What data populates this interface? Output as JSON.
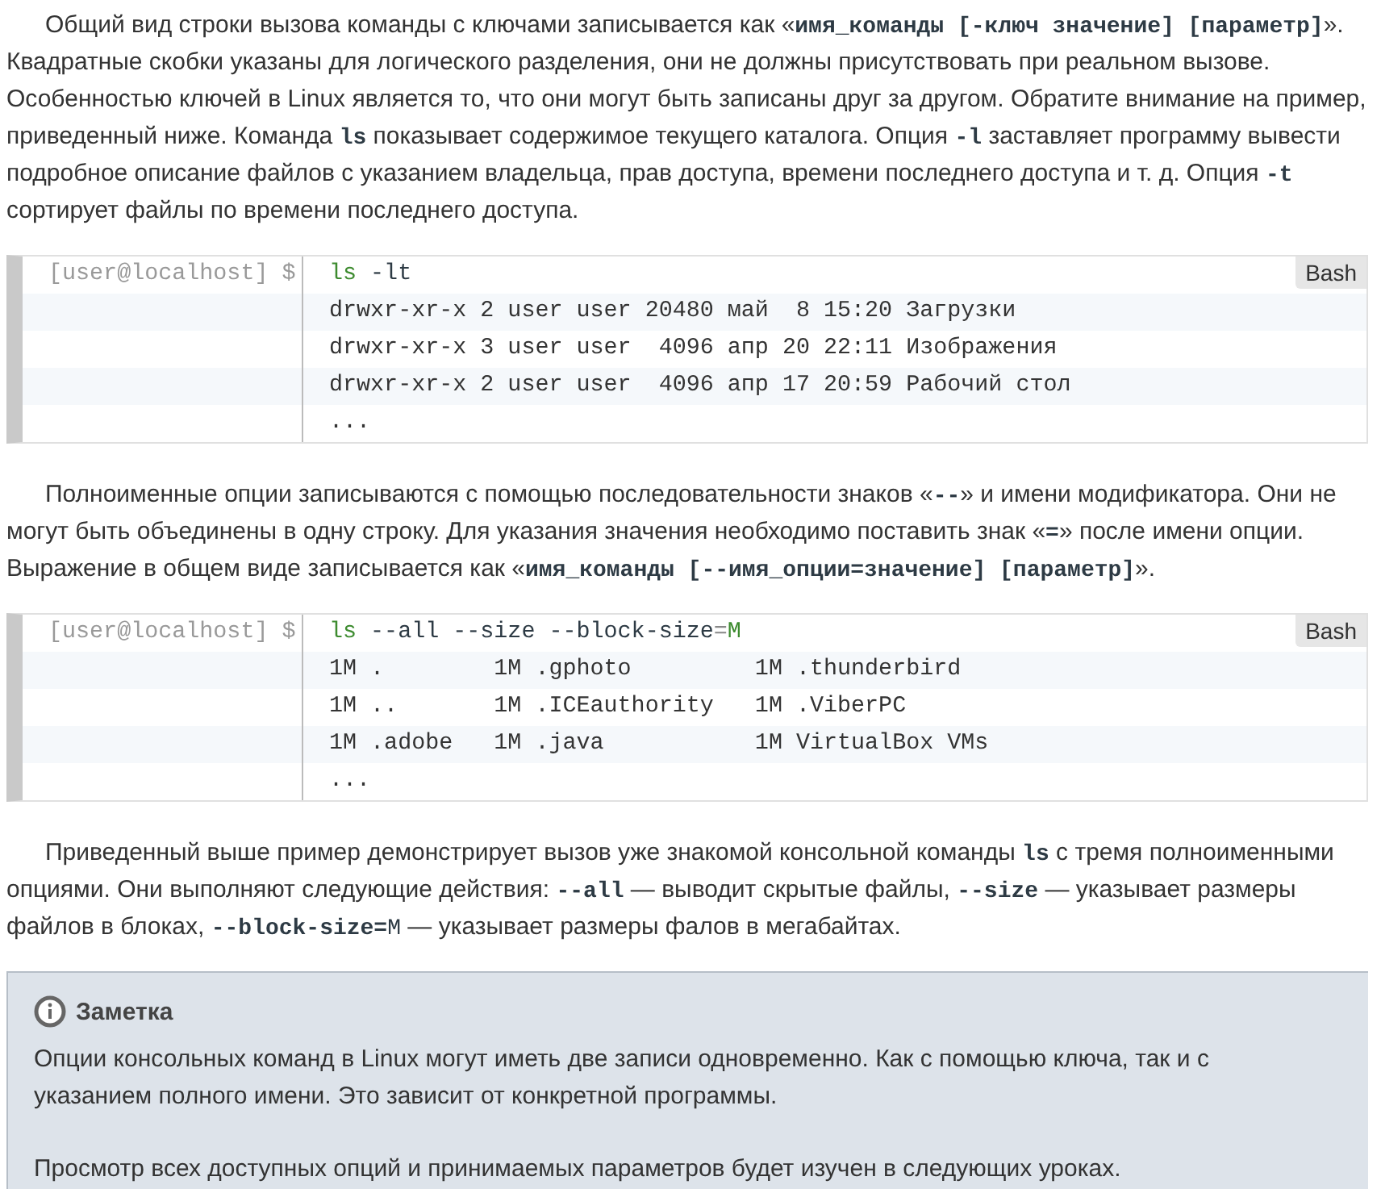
{
  "paragraphs_top": [
    {
      "segments": [
        {
          "kind": "text",
          "text": "Общий вид строки вызова команды с ключами записывается как «"
        },
        {
          "kind": "code",
          "text": "имя_команды [-ключ значение] [параметр]"
        },
        {
          "kind": "text",
          "text": "». Квадратные скобки указаны для логического разделения, они не должны присутствовать при реальном вызове. Особенностью ключей в Linux является то, что они могут быть записаны друг за другом. Обратите внимание на пример, приведенный ниже. Команда "
        },
        {
          "kind": "code",
          "text": "ls"
        },
        {
          "kind": "text",
          "text": " показывает содержимое текущего каталога. Опция "
        },
        {
          "kind": "code",
          "text": "-l"
        },
        {
          "kind": "text",
          "text": " заставляет программу вывести подробное описание файлов с указанием владельца, прав доступа, времени последнего доступа и т. д. Опция  "
        },
        {
          "kind": "code",
          "text": "-t"
        },
        {
          "kind": "text",
          "text": " сортирует файлы по времени последнего доступа."
        }
      ]
    }
  ],
  "code_blocks": [
    {
      "prompt": "[user@localhost] $",
      "language": "Bash",
      "command": [
        {
          "kind": "command",
          "text": "ls"
        },
        {
          "kind": "option",
          "text": " -lt"
        }
      ],
      "output": [
        "drwxr-xr-x 2 user user 20480 май  8 15:20 Загрузки",
        "drwxr-xr-x 3 user user  4096 апр 20 22:11 Изображения",
        "drwxr-xr-x 2 user user  4096 апр 17 20:59 Рабочий стол",
        "..."
      ],
      "after": [
        {
          "segments": [
            {
              "kind": "text",
              "text": "Полноименные опции записываются с помощью последовательности знаков «"
            },
            {
              "kind": "code",
              "text": "--"
            },
            {
              "kind": "text",
              "text": "» и имени модификатора. Они не могут быть объединены в одну строку. Для указания значения необходимо поставить знак «"
            },
            {
              "kind": "code",
              "text": "="
            },
            {
              "kind": "text",
              "text": "» после имени опции. Выражение в общем виде записывается как «"
            },
            {
              "kind": "code",
              "text": "имя_команды [--имя_опции=значение] [параметр]"
            },
            {
              "kind": "text",
              "text": "»."
            }
          ]
        }
      ]
    },
    {
      "prompt": "[user@localhost] $",
      "language": "Bash",
      "command": [
        {
          "kind": "command",
          "text": "ls"
        },
        {
          "kind": "option",
          "text": " --all --size --block-size"
        },
        {
          "kind": "operator",
          "text": "="
        },
        {
          "kind": "command",
          "text": "M"
        }
      ],
      "output": [
        "1M .        1M .gphoto         1M .thunderbird",
        "1M ..       1M .ICEauthority   1M .ViberPC",
        "1M .adobe   1M .java           1M VirtualBox VMs",
        "..."
      ],
      "after": [
        {
          "segments": [
            {
              "kind": "text",
              "text": "Приведенный выше пример демонстрирует вызов уже знакомой консольной команды "
            },
            {
              "kind": "code",
              "text": "ls"
            },
            {
              "kind": "text",
              "text": " с тремя полноименными опциями. Они выполняют следующие действия: "
            },
            {
              "kind": "code",
              "text": "--all"
            },
            {
              "kind": "text",
              "text": " — выводит скрытые файлы, "
            },
            {
              "kind": "code",
              "text": "--size"
            },
            {
              "kind": "text",
              "text": " — указывает размеры файлов в блоках, "
            },
            {
              "kind": "code",
              "text": "--block-size="
            },
            {
              "kind": "code-light",
              "text": "M"
            },
            {
              "kind": "text",
              "text": " — указывает размеры фалов в мегабайтах."
            }
          ]
        }
      ]
    }
  ],
  "note": {
    "title": "Заметка",
    "paragraphs": [
      "Опции консольных команд в Linux могут иметь две записи одновременно. Как с помощью ключа, так и с указанием полного имени. Это зависит от конкретной программы.",
      "Просмотр всех доступных опций и принимаемых параметров будет изучен в следующих уроках."
    ]
  }
}
